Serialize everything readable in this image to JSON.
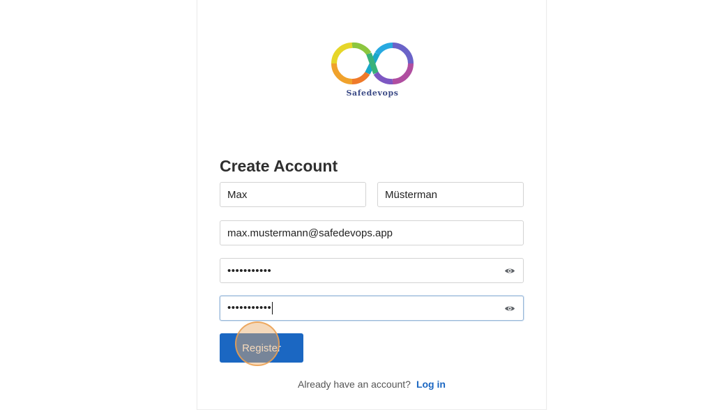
{
  "brand": {
    "name": "Safedevops"
  },
  "form": {
    "title": "Create Account",
    "first_name": "Max",
    "last_name": "Müsterman",
    "email": "max.mustermann@safedevops.app",
    "password_masked": "•••••••••••",
    "confirm_password_masked": "•••••••••••",
    "register_label": "Register"
  },
  "footer": {
    "question": "Already have an account?",
    "login_label": "Log in"
  },
  "colors": {
    "primary": "#1b67c2",
    "heading": "#2f2f2f",
    "brand_text": "#3b4a86"
  },
  "icons": {
    "show_password": "eye-icon",
    "logo": "infinity-logo"
  }
}
